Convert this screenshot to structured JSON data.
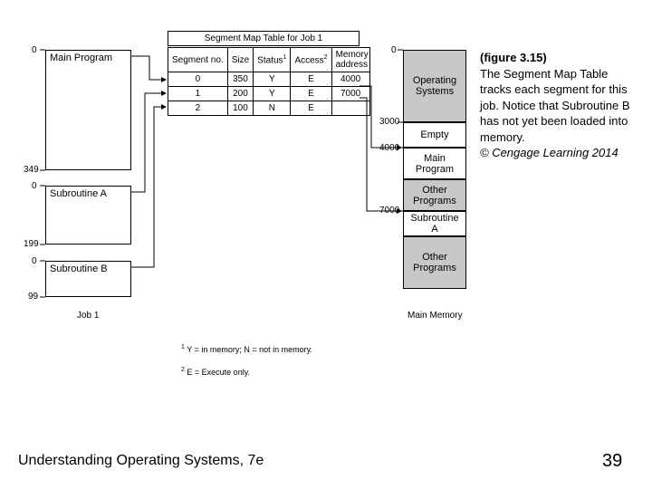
{
  "job1": {
    "main_label": "Main Program",
    "subA_label": "Subroutine A",
    "subB_label": "Subroutine B",
    "main_start": "0",
    "main_end": "349",
    "subA_start": "0",
    "subA_end": "199",
    "subB_start": "0",
    "subB_end": "99",
    "caption": "Job 1"
  },
  "smt": {
    "title": "Segment Map Table for Job 1",
    "headers": {
      "seg": "Segment no.",
      "size": "Size",
      "status": "Status",
      "status_sup": "1",
      "access": "Access",
      "access_sup": "2",
      "addr": "Memory address"
    },
    "rows": [
      {
        "seg": "0",
        "size": "350",
        "status": "Y",
        "access": "E",
        "addr": "4000"
      },
      {
        "seg": "1",
        "size": "200",
        "status": "Y",
        "access": "E",
        "addr": "7000"
      },
      {
        "seg": "2",
        "size": "100",
        "status": "N",
        "access": "E",
        "addr": ""
      }
    ]
  },
  "memory": {
    "os": "Operating Systems",
    "empty": "Empty",
    "main": "Main Program",
    "other1": "Other Programs",
    "subA": "Subroutine A",
    "other2": "Other Programs",
    "m0": "0",
    "m3000": "3000",
    "m4000": "4000",
    "m7000": "7000",
    "caption": "Main Memory"
  },
  "footnotes": {
    "f1_sup": "1",
    "f1": " Y = in memory; N = not in memory.",
    "f2_sup": "2",
    "f2": " E = Execute only."
  },
  "caption": {
    "title": "(figure 3.15)",
    "body": "The Segment Map Table tracks each segment for this job. Notice that Subroutine B has not yet been loaded into memory.",
    "credit": "© Cengage Learning 2014"
  },
  "footer": {
    "left": "Understanding Operating Systems, 7e",
    "right": "39"
  }
}
